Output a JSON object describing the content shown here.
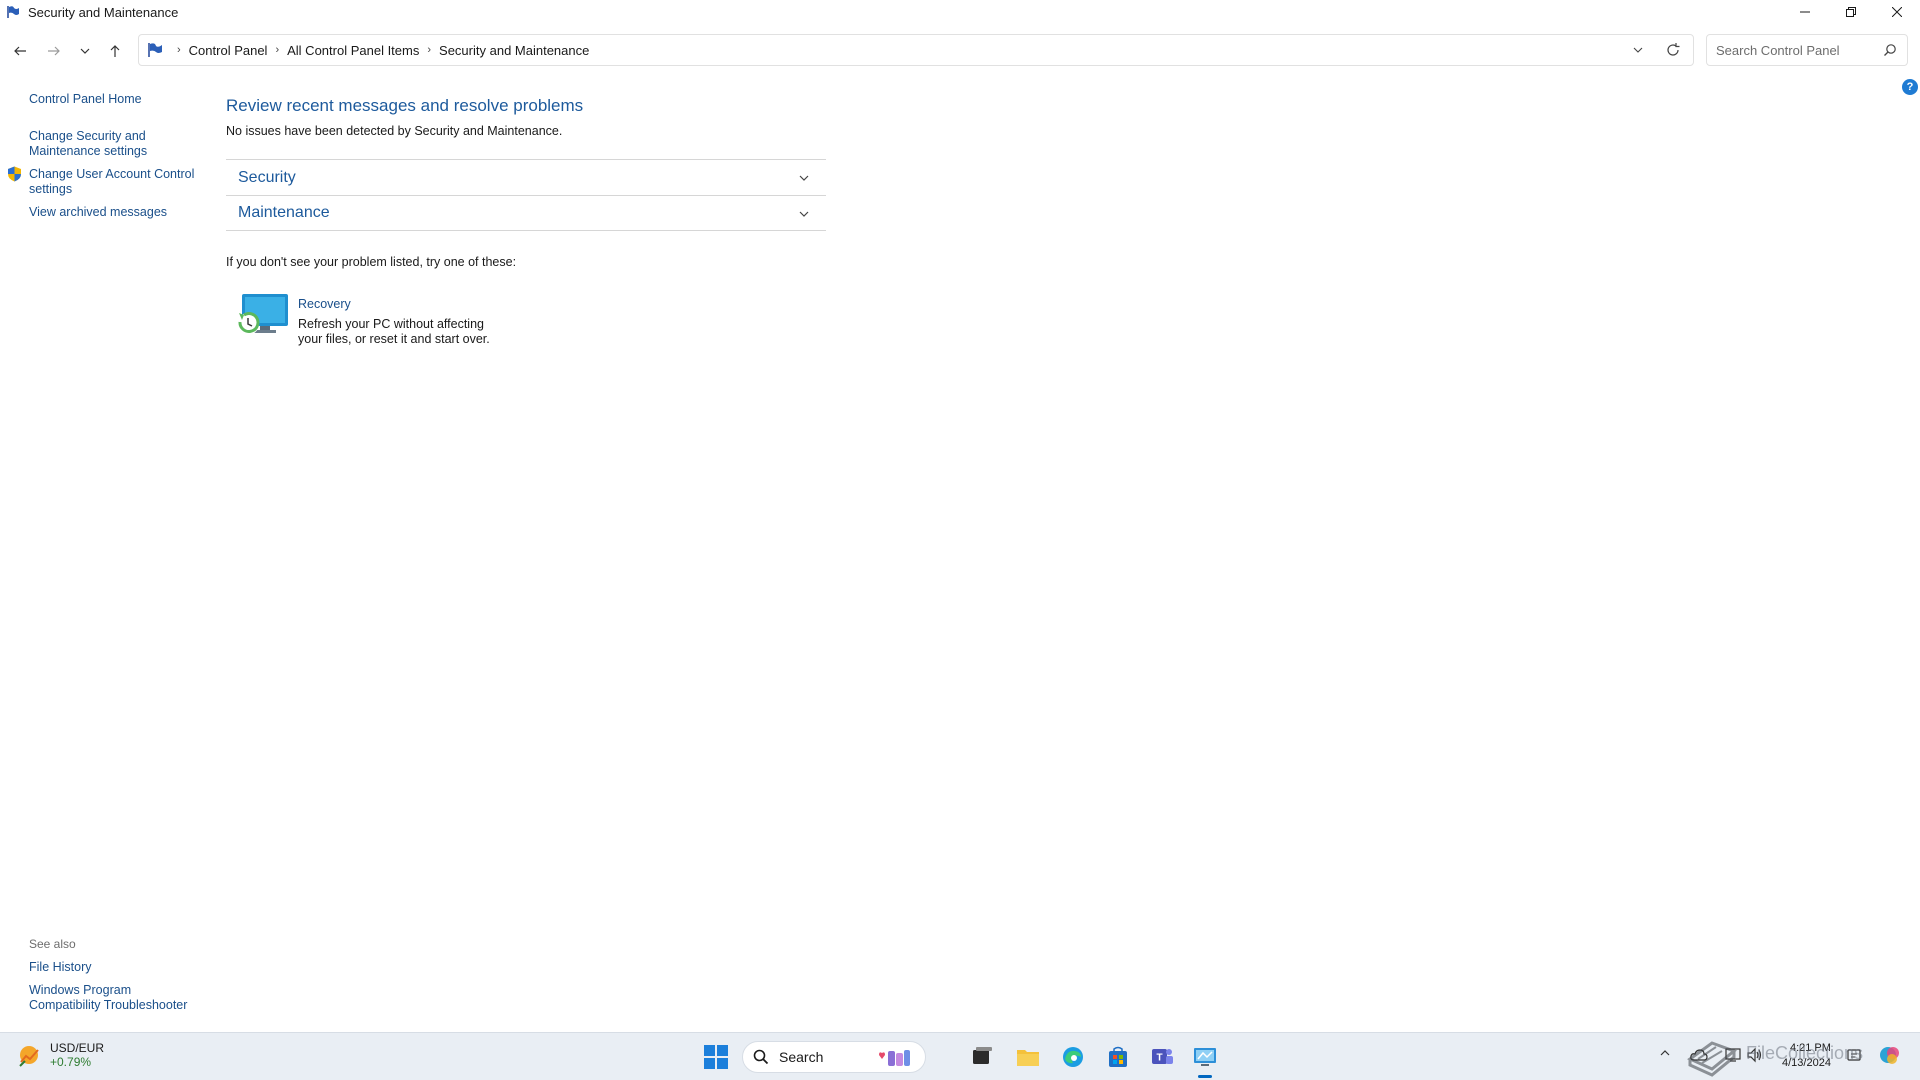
{
  "window": {
    "title": "Security and Maintenance"
  },
  "address": {
    "crumbs": [
      "Control Panel",
      "All Control Panel Items",
      "Security and Maintenance"
    ],
    "search_placeholder": "Search Control Panel"
  },
  "left_pane": {
    "home": "Control Panel Home",
    "change_security_1": "Change Security and",
    "change_security_2": "Maintenance settings",
    "change_uac_1": "Change User Account Control",
    "change_uac_2": "settings",
    "archived": "View archived messages",
    "see_also": "See also",
    "file_history": "File History",
    "compat_1": "Windows Program",
    "compat_2": "Compatibility Troubleshooter"
  },
  "main": {
    "heading": "Review recent messages and resolve problems",
    "subtext": "No issues have been detected by Security and Maintenance.",
    "sections": [
      "Security",
      "Maintenance"
    ],
    "try_text": "If you don't see your problem listed, try one of these:",
    "recovery": {
      "title": "Recovery",
      "desc_1": "Refresh your PC without affecting",
      "desc_2": "your files, or reset it and start over."
    },
    "help_glyph": "?"
  },
  "taskbar": {
    "weather_title": "USD/EUR",
    "weather_value": "+0.79%",
    "search_label": "Search",
    "time": "4:21 PM",
    "date": "4/13/2024",
    "active_app": "control-panel",
    "colors": {
      "accent": "#0067c0",
      "link": "#1a4f8a",
      "heading": "#1d5a9c"
    }
  },
  "watermark": {
    "text": "FileCollections"
  }
}
